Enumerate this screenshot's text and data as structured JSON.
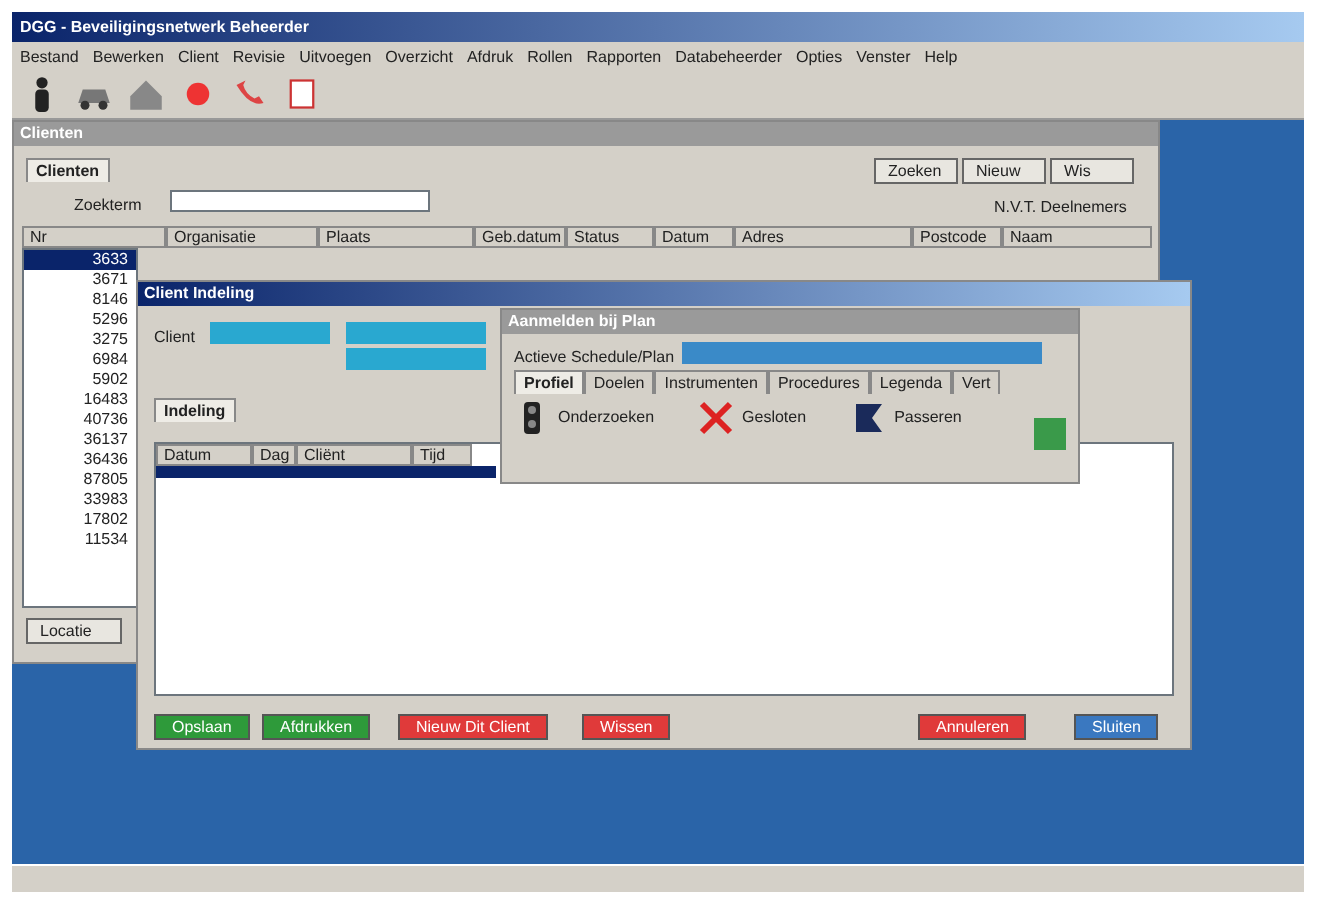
{
  "window": {
    "title": "DGG - Beveiligingsnetwerk Beheerder"
  },
  "menu": [
    "Bestand",
    "Bewerken",
    "Client",
    "Revisie",
    "Uitvoegen",
    "Overzicht",
    "Afdruk",
    "Rollen",
    "Rapporten",
    "Databeheerder",
    "Opties",
    "Venster",
    "Help"
  ],
  "clients_window": {
    "title": "Clienten",
    "tabs": [
      {
        "label": "Clienten",
        "selected": true
      }
    ],
    "search_label": "Zoekterm",
    "buttons": [
      "Zoeken",
      "Nieuw",
      "Wis"
    ],
    "info": "N.V.T. Deelnemers",
    "columns": [
      "Nr",
      "Organisatie",
      "Plaats",
      "Geb.datum",
      "Status",
      "Datum",
      "Adres",
      "Postcode",
      "Naam"
    ],
    "rows": [
      {
        "id": "3633",
        "selected": true
      },
      {
        "id": "3671",
        "selected": false
      },
      {
        "id": "8146",
        "selected": false
      },
      {
        "id": "5296",
        "selected": false
      },
      {
        "id": "3275",
        "selected": false
      },
      {
        "id": "6984",
        "selected": false
      },
      {
        "id": "5902",
        "selected": false
      },
      {
        "id": "16483",
        "selected": false
      },
      {
        "id": "40736",
        "selected": false
      },
      {
        "id": "36137",
        "selected": false
      },
      {
        "id": "36436",
        "selected": false
      },
      {
        "id": "87805",
        "selected": false
      },
      {
        "id": "33983",
        "selected": false
      },
      {
        "id": "17802",
        "selected": false
      },
      {
        "id": "11534",
        "selected": false
      }
    ],
    "bottom_button": "Locatie"
  },
  "dialog": {
    "title": "Client Indeling",
    "client_label": "Client",
    "tabs": [
      {
        "label": "Indeling",
        "selected": true
      }
    ],
    "columns": [
      "Datum",
      "Dag",
      "Cliënt",
      "Tijd"
    ],
    "buttons": [
      {
        "label": "Opslaan",
        "color": "#2e9a3a"
      },
      {
        "label": "Afdrukken",
        "color": "#2e9a3a"
      },
      {
        "label": "Nieuw Dit Client",
        "color": "#e03a3a"
      },
      {
        "label": "Wissen",
        "color": "#e03a3a"
      },
      {
        "label": "Annuleren",
        "color": "#e03a3a"
      },
      {
        "label": "Sluiten",
        "color": "#3a78c0"
      }
    ]
  },
  "popup": {
    "title": "Aanmelden bij Plan",
    "field_label": "Actieve Schedule/Plan",
    "tabs": [
      {
        "label": "Profiel",
        "selected": true
      },
      {
        "label": "Doelen",
        "selected": false
      },
      {
        "label": "Instrumenten",
        "selected": false
      },
      {
        "label": "Procedures",
        "selected": false
      },
      {
        "label": "Legenda",
        "selected": false
      },
      {
        "label": "Vert",
        "selected": false
      }
    ],
    "actions": [
      {
        "kind": "signal",
        "label": "Onderzoeken"
      },
      {
        "kind": "cross",
        "label": "Gesloten"
      },
      {
        "kind": "flag",
        "label": "Passeren"
      }
    ]
  }
}
